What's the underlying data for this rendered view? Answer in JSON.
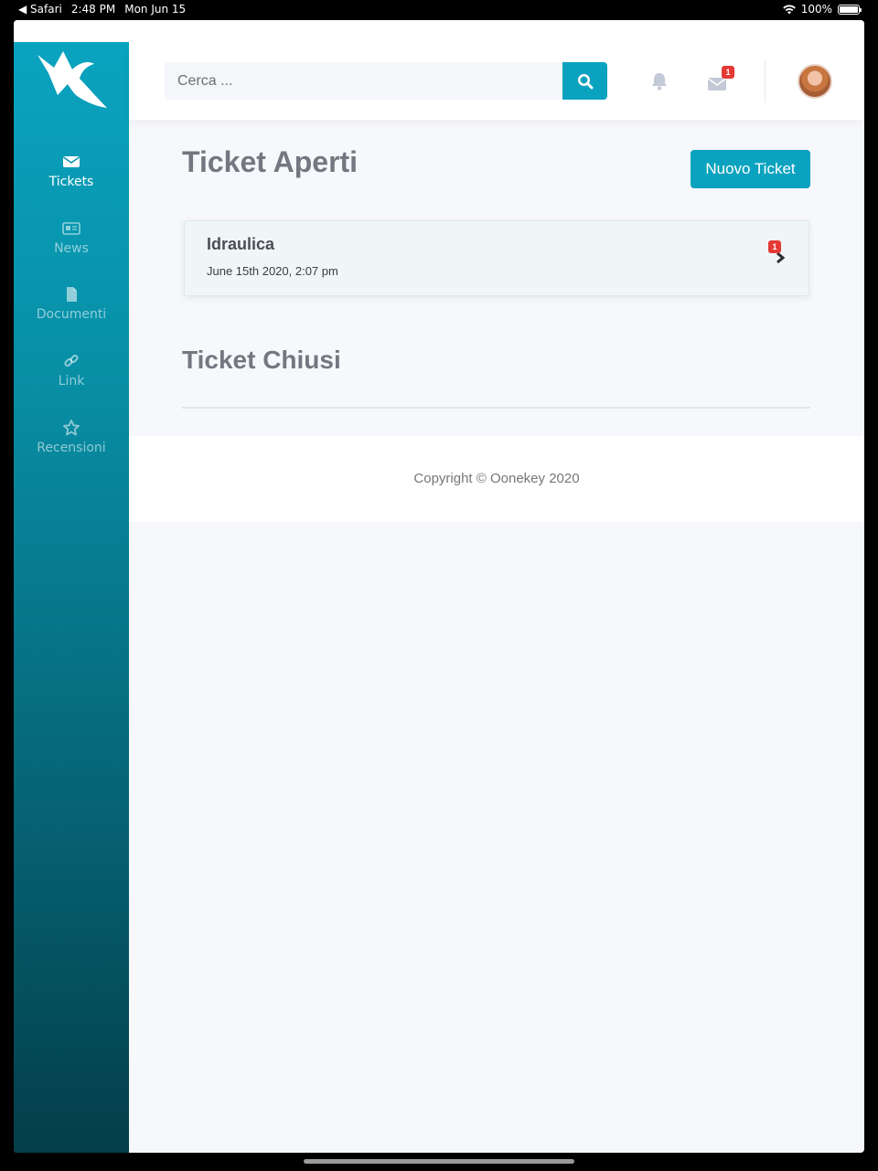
{
  "status_bar": {
    "back_app": "◀ Safari",
    "time": "2:48 PM",
    "date": "Mon Jun 15",
    "battery": "100%",
    "battery_level": 1.0
  },
  "sidebar": {
    "items": [
      {
        "label": "Tickets",
        "icon": "envelope-icon",
        "active": true
      },
      {
        "label": "News",
        "icon": "newspaper-icon",
        "active": false
      },
      {
        "label": "Documenti",
        "icon": "file-icon",
        "active": false
      },
      {
        "label": "Link",
        "icon": "link-icon",
        "active": false
      },
      {
        "label": "Recensioni",
        "icon": "star-icon",
        "active": false
      }
    ]
  },
  "header": {
    "search_placeholder": "Cerca ...",
    "mail_badge": "1"
  },
  "main": {
    "open_title": "Ticket Aperti",
    "new_ticket_label": "Nuovo Ticket",
    "tickets": [
      {
        "title": "Idraulica",
        "date": "June 15th 2020, 2:07 pm",
        "badge": "1"
      }
    ],
    "closed_title": "Ticket Chiusi"
  },
  "footer": {
    "copyright": "Copyright © Oonekey 2020"
  },
  "colors": {
    "accent": "#0aa2bf",
    "badge": "#e53935",
    "background": "#f7f8fb"
  }
}
